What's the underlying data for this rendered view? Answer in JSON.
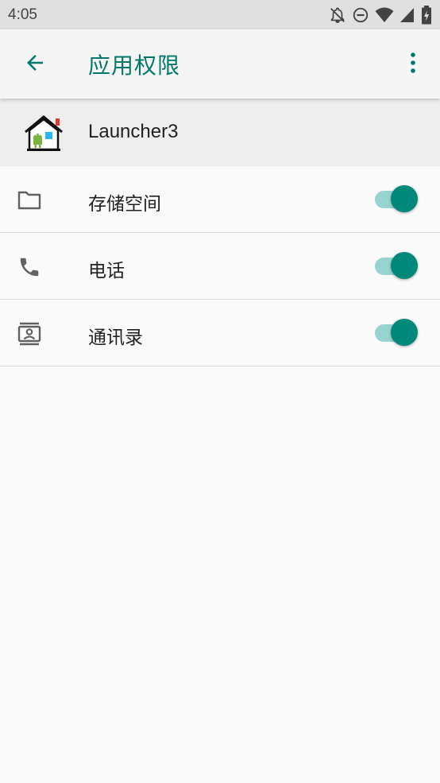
{
  "status_bar": {
    "time": "4:05",
    "icons": [
      "notifications-off-icon",
      "do-not-disturb-icon",
      "wifi-icon",
      "cell-signal-icon",
      "battery-charging-icon"
    ]
  },
  "app_bar": {
    "title": "应用权限",
    "back_icon": "arrow-back-icon",
    "overflow_icon": "more-vert-icon",
    "accent_color": "#00796b"
  },
  "app": {
    "name": "Launcher3",
    "icon": "launcher-house-icon"
  },
  "permissions": [
    {
      "label": "存储空间",
      "icon": "folder-icon",
      "enabled": true
    },
    {
      "label": "电话",
      "icon": "phone-icon",
      "enabled": true
    },
    {
      "label": "通讯录",
      "icon": "contacts-icon",
      "enabled": true
    }
  ],
  "colors": {
    "switch_thumb_on": "#00897b",
    "switch_track_on": "#80cbc4"
  }
}
